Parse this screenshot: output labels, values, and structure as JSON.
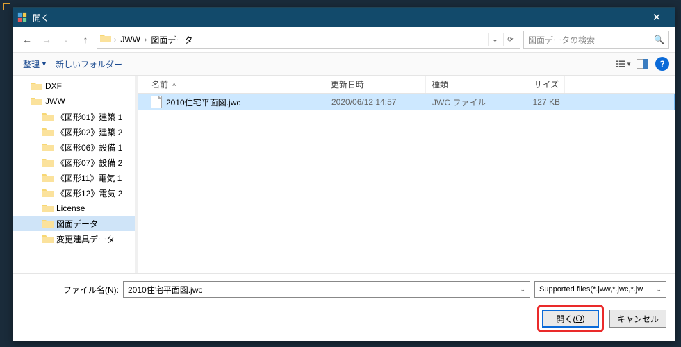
{
  "colors": {
    "titlebar": "#124a6b",
    "selection": "#cde8ff",
    "highlight": "#ea2a2a",
    "help": "#0a6ad8"
  },
  "window": {
    "title": "開く"
  },
  "nav": {
    "back_enabled": true,
    "forward_enabled": false,
    "up_enabled": true,
    "crumbs": [
      "JWW",
      "図面データ"
    ]
  },
  "search": {
    "placeholder": "図面データの検索"
  },
  "toolbar": {
    "organize": "整理",
    "new_folder": "新しいフォルダー"
  },
  "tree": {
    "items": [
      {
        "label": "DXF",
        "indent": 1,
        "selected": false
      },
      {
        "label": "JWW",
        "indent": 1,
        "selected": false
      },
      {
        "label": "《図形01》建築 1",
        "indent": 2,
        "selected": false
      },
      {
        "label": "《図形02》建築 2",
        "indent": 2,
        "selected": false
      },
      {
        "label": "《図形06》設備 1",
        "indent": 2,
        "selected": false
      },
      {
        "label": "《図形07》設備 2",
        "indent": 2,
        "selected": false
      },
      {
        "label": "《図形11》電気 1",
        "indent": 2,
        "selected": false
      },
      {
        "label": "《図形12》電気 2",
        "indent": 2,
        "selected": false
      },
      {
        "label": "License",
        "indent": 2,
        "selected": false
      },
      {
        "label": "図面データ",
        "indent": 2,
        "selected": true
      },
      {
        "label": "変更建具データ",
        "indent": 2,
        "selected": false
      }
    ]
  },
  "columns": {
    "name": "名前",
    "date": "更新日時",
    "type": "種類",
    "size": "サイズ",
    "sorted_by": "name",
    "sort_dir": "asc"
  },
  "files": [
    {
      "name": "2010住宅平面図.jwc",
      "date": "2020/06/12 14:57",
      "type": "JWC ファイル",
      "size": "127 KB",
      "selected": true
    }
  ],
  "footer": {
    "filename_label_pre": "ファイル名(",
    "filename_label_key": "N",
    "filename_label_post": "):",
    "filename_value": "2010住宅平面図.jwc",
    "filetype_value": "Supported files(*.jww,*.jwc,*.jw",
    "open_label_pre": "開く(",
    "open_label_key": "O",
    "open_label_post": ")",
    "cancel_label": "キャンセル"
  }
}
